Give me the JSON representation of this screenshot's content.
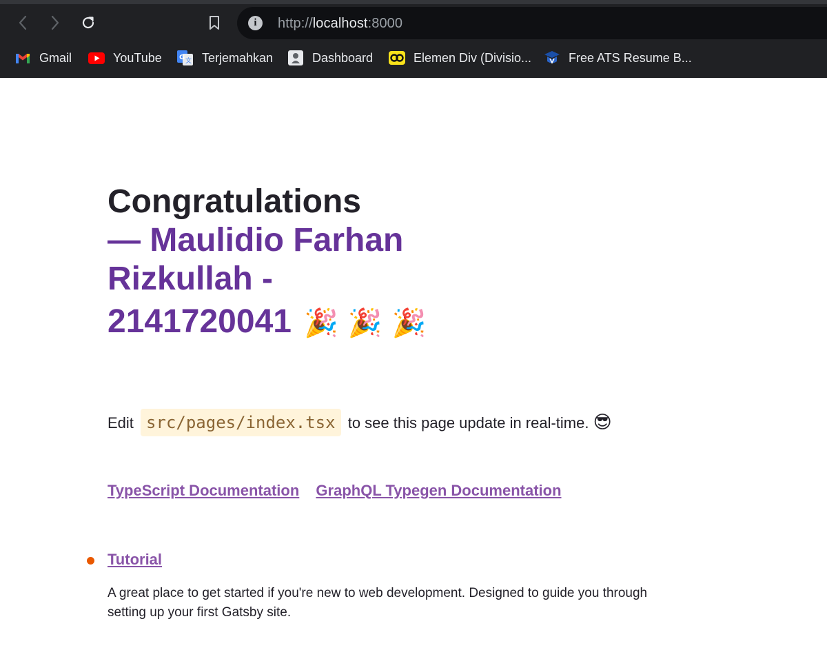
{
  "browser": {
    "url": {
      "scheme": "http://",
      "host": "localhost",
      "port": ":8000"
    },
    "bookmarks": [
      {
        "label": "Gmail",
        "icon": "gmail-icon"
      },
      {
        "label": "YouTube",
        "icon": "youtube-icon"
      },
      {
        "label": "Terjemahkan",
        "icon": "translate-icon"
      },
      {
        "label": "Dashboard",
        "icon": "dashboard-icon"
      },
      {
        "label": "Elemen Div (Divisio...",
        "icon": "codepolitan-icon"
      },
      {
        "label": "Free ATS Resume B...",
        "icon": "resume-builder-icon"
      }
    ]
  },
  "page": {
    "heading": "Congratulations",
    "heading_accent_line1": "— Maulidio Farhan",
    "heading_accent_line2": "Rizkullah -",
    "heading_accent_line3": "2141720041",
    "party_emoji": "🎉",
    "paragraph": {
      "before": "Edit",
      "code": "src/pages/index.tsx",
      "after": "to see this page update in real-time.",
      "emoji": "😎"
    },
    "doc_links": [
      {
        "label": "TypeScript Documentation"
      },
      {
        "label": "GraphQL Typegen Documentation"
      }
    ],
    "list": [
      {
        "title": "Tutorial",
        "description": "A great place to get started if you're new to web development. Designed to guide you through setting up your first Gatsby site."
      }
    ]
  },
  "colors": {
    "accent": "#663399",
    "link": "#8954a8",
    "bullet": "#e95800",
    "code_bg": "#fff4db",
    "code_text": "#8a6534",
    "chrome_bg": "#202124"
  }
}
